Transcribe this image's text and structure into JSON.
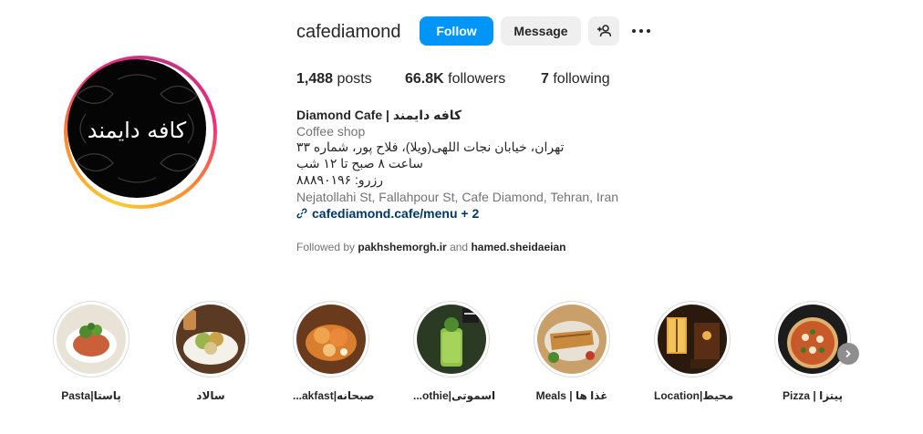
{
  "profile": {
    "username": "cafediamond",
    "follow_label": "Follow",
    "message_label": "Message",
    "add_user_icon": "add-person-icon",
    "more_icon": "more-options-icon",
    "avatar_text": "کافه دایمند"
  },
  "stats": {
    "posts_count": "1,488",
    "posts_label": " posts",
    "followers_count": "66.8K",
    "followers_label": " followers",
    "following_count": "7",
    "following_label": " following"
  },
  "bio": {
    "name": "Diamond Cafe | کافه دایمند",
    "category": "Coffee shop",
    "line1": "تهران، خیابان نجات اللهی(ویلا)، فلاح پور، شماره ۳۳",
    "line2": "ساعت ۸ صبح تا ۱۲ شب",
    "line3": "رزرو: ۸۸۸۹۰۱۹۶",
    "address": "Nejatollahi St, Fallahpour St, Cafe Diamond, Tehran, Iran",
    "link": "cafediamond.cafe/menu + 2",
    "followed_prefix": "Followed by ",
    "followed_user1": "pakhshemorgh.ir",
    "followed_and": " and ",
    "followed_user2": "hamed.sheidaeian"
  },
  "highlights": [
    {
      "label": "Pasta|پاستا",
      "color": "#c9603a"
    },
    {
      "label": "سالاد",
      "color": "#8fa84a"
    },
    {
      "label": "...akfast|صبحانه",
      "color": "#c9792e"
    },
    {
      "label": "...othie|اسموتی",
      "color": "#7fb548"
    },
    {
      "label": "Meals | غذا ها",
      "color": "#b8874a"
    },
    {
      "label": "Location|محیط",
      "color": "#b06a1e"
    },
    {
      "label": "Pizza | پیتزا",
      "color": "#a8442a"
    }
  ],
  "colors": {
    "accent": "#0095f6",
    "link": "#00376b"
  }
}
